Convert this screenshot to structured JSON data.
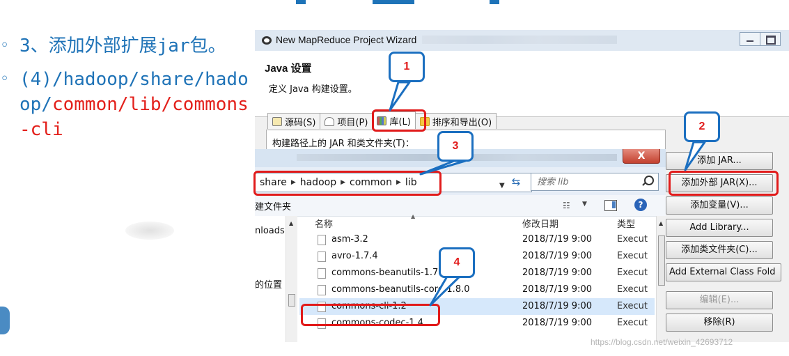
{
  "slide": {
    "bullet1": "3、添加外部扩展jar包。",
    "bullet2_prefix": "(4)/hadoop/share/hadoop/",
    "bullet2_red": "common/lib/commons-cli"
  },
  "wizard": {
    "title": "New MapReduce Project Wizard",
    "heading": "Java 设置",
    "subtitle": "定义 Java 构建设置。",
    "tabs": [
      "源码(S)",
      "项目(P)",
      "库(L)",
      "排序和导出(O)"
    ],
    "jar_label": "构建路径上的 JAR 和类文件夹(T)：",
    "buttons": {
      "add_jar": "添加 JAR...",
      "add_external_jar": "添加外部 JAR(X)...",
      "add_variable": "添加变量(V)...",
      "add_library": "Add Library...",
      "add_class_folder": "添加类文件夹(C)...",
      "add_external_class_folder": "Add External Class Fold",
      "edit": "编辑(E)...",
      "remove": "移除(R)"
    }
  },
  "file_dialog": {
    "close_label": "X",
    "breadcrumb": [
      "share",
      "hadoop",
      "common",
      "lib"
    ],
    "search_placeholder": "搜索 lib",
    "new_folder": "建文件夹",
    "nav_items": [
      "nloads",
      "的位置"
    ],
    "columns": {
      "name": "名称",
      "date": "修改日期",
      "type": "类型"
    },
    "files": [
      {
        "name": "asm-3.2",
        "date": "2018/7/19 9:00",
        "type": "Execut"
      },
      {
        "name": "avro-1.7.4",
        "date": "2018/7/19 9:00",
        "type": "Execut"
      },
      {
        "name": "commons-beanutils-1.7",
        "date": "2018/7/19 9:00",
        "type": "Execut"
      },
      {
        "name": "commons-beanutils-core-1.8.0",
        "date": "2018/7/19 9:00",
        "type": "Execut"
      },
      {
        "name": "commons-cli-1.2",
        "date": "2018/7/19 9:00",
        "type": "Execut"
      },
      {
        "name": "commons-codec-1.4",
        "date": "2018/7/19 9:00",
        "type": "Execut"
      }
    ],
    "selected_index": 4
  },
  "annotations": [
    "1",
    "2",
    "3",
    "4"
  ],
  "watermark": "https://blog.csdn.net/weixin_42693712",
  "colors": {
    "accent_blue": "#1f73b7",
    "annotation_red": "#e11b1b",
    "callout_border": "#1b6fc0"
  }
}
